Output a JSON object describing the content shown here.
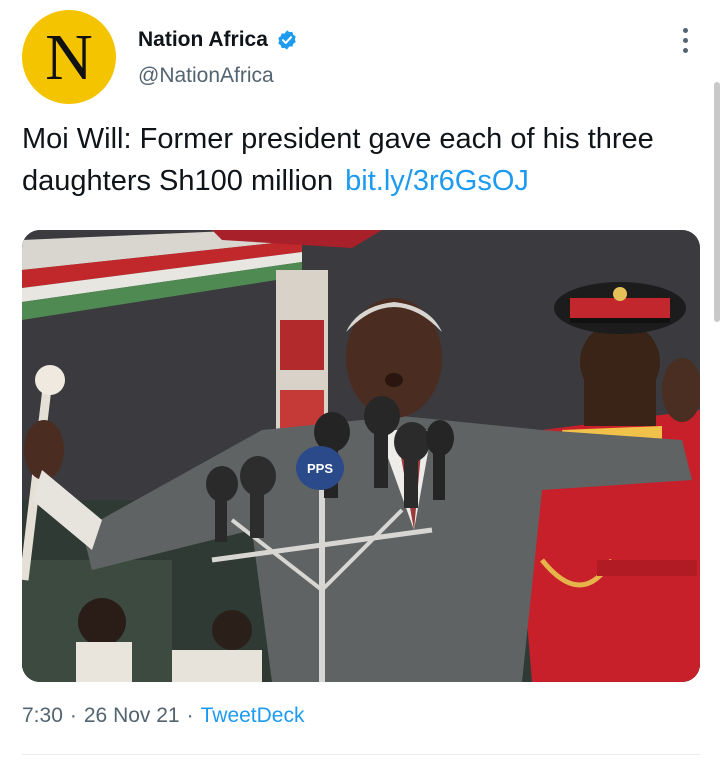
{
  "author": {
    "avatar_letter": "N",
    "display_name": "Nation Africa",
    "handle": "@NationAfrica",
    "verified_icon": "verified-badge-icon"
  },
  "tweet": {
    "text": "Moi Will: Former president gave each of his three daughters Sh100 million",
    "link": "bit.ly/3r6GsOJ"
  },
  "media": {
    "mic_label": "PPS"
  },
  "meta": {
    "time": "7:30",
    "separator": "·",
    "date": "26 Nov 21",
    "source": "TweetDeck"
  },
  "menu_icon": "more-vertical-icon",
  "colors": {
    "link": "#1d9bf0",
    "avatar_bg": "#f5c400",
    "muted": "#536471",
    "uniform_red": "#c8202a"
  }
}
